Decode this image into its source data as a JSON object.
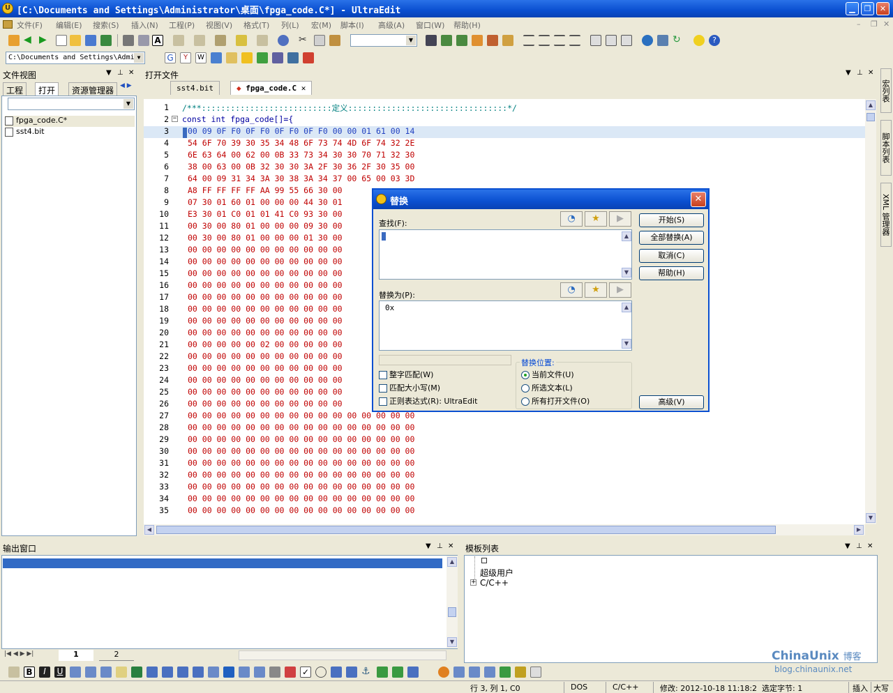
{
  "window": {
    "title": "[C:\\Documents and Settings\\Administrator\\桌面\\fpga_code.C*] - UltraEdit"
  },
  "menu": [
    "文件(F)",
    "编辑(E)",
    "搜索(S)",
    "插入(N)",
    "工程(P)",
    "视图(V)",
    "格式(T)",
    "列(L)",
    "宏(M)",
    "脚本(I)",
    "高级(A)",
    "窗口(W)",
    "帮助(H)"
  ],
  "toolbar2": {
    "path_combo": "C:\\Documents and Settings\\Admi"
  },
  "fileview": {
    "title": "文件视图",
    "tabs": [
      "工程",
      "打开",
      "资源管理器"
    ],
    "files": [
      "fpga_code.C*",
      "sst4.bit"
    ]
  },
  "editor": {
    "title": "打开文件",
    "tabs": [
      "sst4.bit",
      "fpga_code.C"
    ],
    "line_numbers": [
      "1",
      "2",
      "3",
      "4",
      "5",
      "6",
      "7",
      "8",
      "9",
      "10",
      "11",
      "12",
      "13",
      "14",
      "15",
      "16",
      "17",
      "18",
      "19",
      "20",
      "21",
      "22",
      "23",
      "24",
      "25",
      "26",
      "27",
      "28",
      "29",
      "30",
      "31",
      "32",
      "33",
      "34",
      "35"
    ],
    "line1": "/***:::::::::::::::::::::::::::定义:::::::::::::::::::::::::::::::::*/",
    "line2": "const int fpga_code[]={",
    "hex_rows": [
      "00 09 0F F0 0F F0 0F F0 0F F0 00 00 01 61 00 14",
      "54 6F 70 39 30 35 34 48 6F 73 74 4D 6F 74 32 2E",
      "6E 63 64 00 62 00 0B 33 73 34 30 30 70 71 32 30",
      "38 00 63 00 0B 32 30 30 3A 2F 30 36 2F 30 35 00",
      "64 00 09 31 34 3A 30 38 3A 34 37 00 65 00 03 3D",
      "A8 FF FF FF FF AA 99 55 66 30 00",
      "07 30 01 60 01 00 00 00 44 30 01",
      "E3 30 01 C0 01 01 41 C0 93 30 00",
      "00 30 00 80 01 00 00 00 09 30 00",
      "00 30 00 80 01 00 00 00 01 30 00",
      "00 00 00 00 00 00 00 00 00 00 00",
      "00 00 00 00 00 00 00 00 00 00 00",
      "00 00 00 00 00 00 00 00 00 00 00",
      "00 00 00 00 00 00 00 00 00 00 00",
      "00 00 00 00 00 00 00 00 00 00 00",
      "00 00 00 00 00 00 00 00 00 00 00",
      "00 00 00 00 00 00 00 00 00 00 00",
      "00 00 00 00 00 00 00 00 00 00 00",
      "00 00 00 00 00 02 00 00 00 00 00",
      "00 00 00 00 00 00 00 00 00 00 00",
      "00 00 00 00 00 00 00 00 00 00 00",
      "00 00 00 00 00 00 00 00 00 00 00",
      "00 00 00 00 00 00 00 00 00 00 00",
      "00 00 00 00 00 00 00 00 00 00 00",
      "00 00 00 00 00 00 00 00 00 00 00 00 00 00 00 00",
      "00 00 00 00 00 00 00 00 00 00 00 00 00 00 00 00",
      "00 00 00 00 00 00 00 00 00 00 00 00 00 00 00 00",
      "00 00 00 00 00 00 00 00 00 00 00 00 00 00 00 00",
      "00 00 00 00 00 00 00 00 00 00 00 00 00 00 00 00",
      "00 00 00 00 00 00 00 00 00 00 00 00 00 00 00 00",
      "00 00 00 00 00 00 00 00 00 00 00 00 00 00 00 00",
      "00 00 00 00 00 00 00 00 00 00 00 00 00 00 00 00",
      "00 00 00 00 00 00 00 00 00 00 00 00 00 00 00 00"
    ]
  },
  "dialog": {
    "title": "替换",
    "find_label": "查找(F):",
    "find_value": "",
    "replace_label": "替换为(P):",
    "replace_value": "0x",
    "buttons": [
      "开始(S)",
      "全部替换(A)",
      "取消(C)",
      "帮助(H)"
    ],
    "advanced_button": "高级(V)",
    "checks": [
      "整字匹配(W)",
      "匹配大小写(M)",
      "正则表达式(R): UltraEdit"
    ],
    "scope_label": "替换位置:",
    "scope_options": [
      "当前文件(U)",
      "所选文本(L)",
      "所有打开文件(O)"
    ],
    "scope_selected": 0
  },
  "output": {
    "title": "输出窗口",
    "tabs": [
      "1",
      "2"
    ]
  },
  "templates": {
    "title": "模板列表",
    "items": [
      "超级用户",
      "C/C++"
    ]
  },
  "side_tabs": [
    "宏列表",
    "脚本列表",
    "XML 管理器"
  ],
  "status": {
    "position": "行 3, 列 1, C0",
    "line_ending": "DOS",
    "language": "C/C++",
    "modified": "修改: 2012-10-18 11:18:2",
    "selected": "选定字节: 1",
    "insert": "插入",
    "caps": "大写"
  },
  "watermark": {
    "brand": "ChinaUnix",
    "suffix": "博客",
    "url": "blog.chinaunix.net"
  }
}
